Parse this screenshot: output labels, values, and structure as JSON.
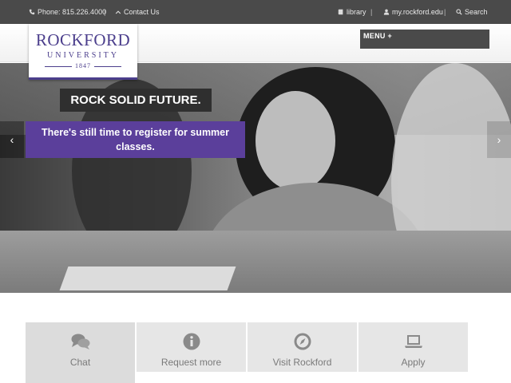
{
  "topbar": {
    "phone": "Phone: 815.226.4000",
    "separator": "|",
    "contact": "Contact Us",
    "library": "library",
    "portal": "my.rockford.edu",
    "search": "Search"
  },
  "logo": {
    "name": "ROCKFORD",
    "sub": "UNIVERSITY",
    "year": "1847"
  },
  "menu": {
    "label": "MENU +"
  },
  "hero": {
    "headline": "ROCK SOLID FUTURE.",
    "message": "There's still time to register for summer classes.",
    "prev": "‹",
    "next": "›"
  },
  "tiles": [
    {
      "label": "Chat",
      "icon": "chat-icon"
    },
    {
      "label": "Request more",
      "icon": "info-icon"
    },
    {
      "label": "Visit Rockford",
      "icon": "compass-icon"
    },
    {
      "label": "Apply",
      "icon": "laptop-icon"
    }
  ],
  "colors": {
    "brand_purple": "#5b3f9b",
    "logo_purple": "#4b3e8c",
    "dark_gray": "#4a4a4a"
  }
}
